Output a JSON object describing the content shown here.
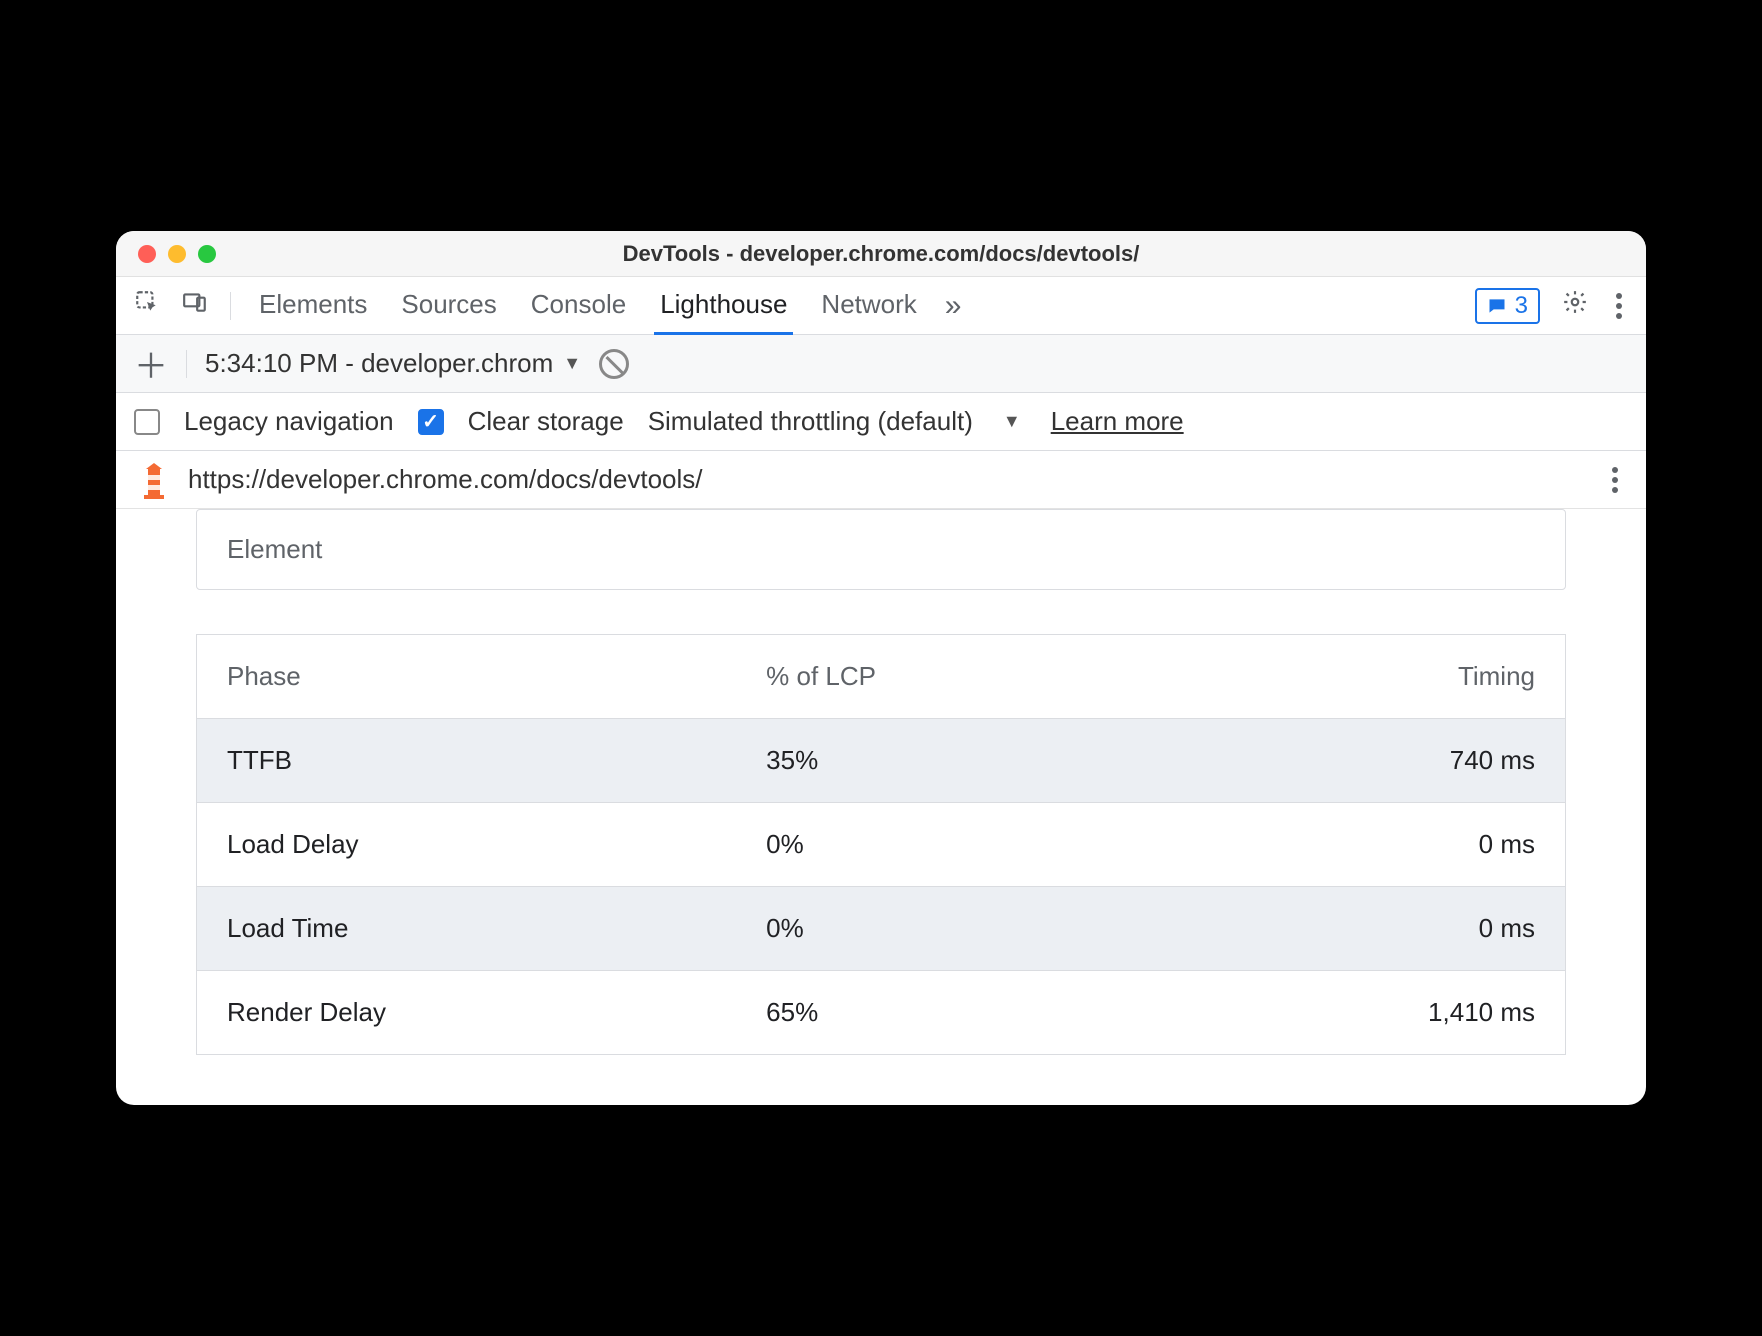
{
  "title": "DevTools - developer.chrome.com/docs/devtools/",
  "tabs": {
    "elements": "Elements",
    "sources": "Sources",
    "console": "Console",
    "lighthouse": "Lighthouse",
    "network": "Network"
  },
  "overflow_glyph": "»",
  "msg_count": "3",
  "report_selector": "5:34:10 PM - developer.chrom",
  "opts": {
    "legacy": "Legacy navigation",
    "clear": "Clear storage",
    "throttling": "Simulated throttling (default)",
    "learn": "Learn more"
  },
  "report_url": "https://developer.chrome.com/docs/devtools/",
  "element_card_title": "Element",
  "phase_table": {
    "headers": {
      "phase": "Phase",
      "pct": "% of LCP",
      "timing": "Timing"
    },
    "rows": [
      {
        "phase": "TTFB",
        "pct": "35%",
        "timing": "740 ms"
      },
      {
        "phase": "Load Delay",
        "pct": "0%",
        "timing": "0 ms"
      },
      {
        "phase": "Load Time",
        "pct": "0%",
        "timing": "0 ms"
      },
      {
        "phase": "Render Delay",
        "pct": "65%",
        "timing": "1,410 ms"
      }
    ]
  }
}
